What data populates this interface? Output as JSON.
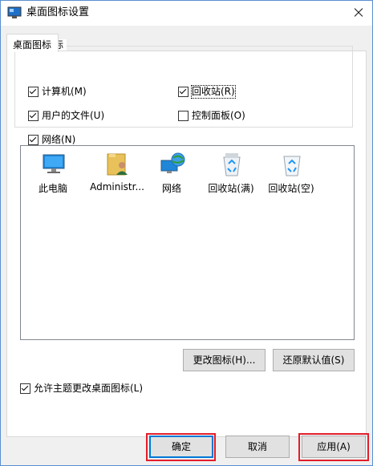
{
  "window": {
    "title": "桌面图标设置"
  },
  "tabs": [
    {
      "label": "桌面图标"
    }
  ],
  "desktop_icons_group": {
    "legend": "桌面图标",
    "checkboxes": [
      {
        "label": "计算机(M)",
        "checked": true
      },
      {
        "label": "回收站(R)",
        "checked": true
      },
      {
        "label": "用户的文件(U)",
        "checked": true
      },
      {
        "label": "控制面板(O)",
        "checked": false
      },
      {
        "label": "网络(N)",
        "checked": true
      }
    ]
  },
  "icon_list": [
    {
      "label": "此电脑",
      "icon": "computer-icon"
    },
    {
      "label": "Administr...",
      "icon": "user-folder-icon"
    },
    {
      "label": "网络",
      "icon": "network-icon"
    },
    {
      "label": "回收站(满)",
      "icon": "recycle-bin-full-icon"
    },
    {
      "label": "回收站(空)",
      "icon": "recycle-bin-empty-icon"
    }
  ],
  "buttons": {
    "change_icon": "更改图标(H)...",
    "restore_default": "还原默认值(S)",
    "ok": "确定",
    "cancel": "取消",
    "apply": "应用(A)"
  },
  "allow_themes": {
    "label": "允许主题更改桌面图标(L)",
    "checked": true
  },
  "colors": {
    "highlight": "#e21e2a",
    "accent": "#0078d7"
  }
}
